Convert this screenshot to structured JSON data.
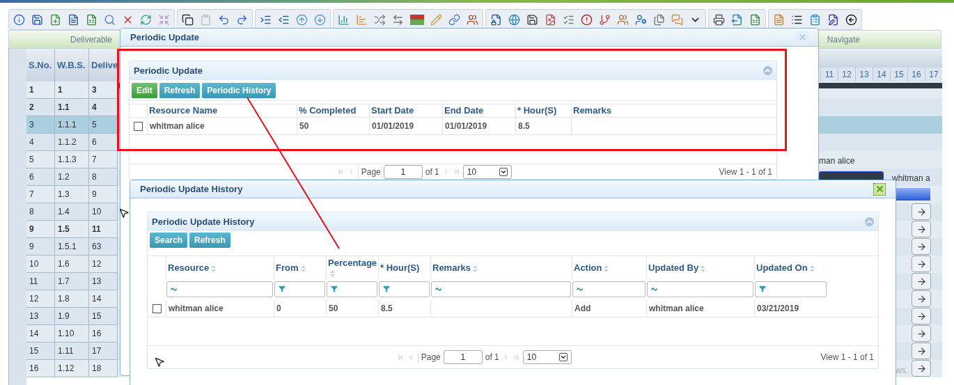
{
  "section_headers": [
    {
      "label": "Deliverable"
    },
    {
      "label": "Navigate"
    }
  ],
  "grid": {
    "columns": [
      "S.No.",
      "W.B.S.",
      "Delive"
    ],
    "rows": [
      {
        "s_no": "1",
        "wbs": "1",
        "deliverable": "3",
        "bold": true,
        "selected": false
      },
      {
        "s_no": "2",
        "wbs": "1.1",
        "deliverable": "4",
        "bold": true,
        "selected": false
      },
      {
        "s_no": "3",
        "wbs": "1.1.1",
        "deliverable": "5",
        "bold": false,
        "selected": true
      },
      {
        "s_no": "4",
        "wbs": "1.1.2",
        "deliverable": "6",
        "bold": false,
        "selected": false
      },
      {
        "s_no": "5",
        "wbs": "1.1.3",
        "deliverable": "7",
        "bold": false,
        "selected": false
      },
      {
        "s_no": "6",
        "wbs": "1.2",
        "deliverable": "8",
        "bold": false,
        "selected": false
      },
      {
        "s_no": "7",
        "wbs": "1.3",
        "deliverable": "9",
        "bold": false,
        "selected": false
      },
      {
        "s_no": "8",
        "wbs": "1.4",
        "deliverable": "10",
        "bold": false,
        "selected": false
      },
      {
        "s_no": "9",
        "wbs": "1.5",
        "deliverable": "11",
        "bold": true,
        "selected": false
      },
      {
        "s_no": "9",
        "wbs": "1.5.1",
        "deliverable": "63",
        "bold": false,
        "selected": false
      },
      {
        "s_no": "10",
        "wbs": "1.6",
        "deliverable": "12",
        "bold": false,
        "selected": false
      },
      {
        "s_no": "11",
        "wbs": "1.7",
        "deliverable": "13",
        "bold": false,
        "selected": false
      },
      {
        "s_no": "12",
        "wbs": "1.8",
        "deliverable": "14",
        "bold": false,
        "selected": false
      },
      {
        "s_no": "13",
        "wbs": "1.9",
        "deliverable": "15",
        "bold": false,
        "selected": false
      },
      {
        "s_no": "14",
        "wbs": "1.10",
        "deliverable": "16",
        "bold": false,
        "selected": false
      },
      {
        "s_no": "15",
        "wbs": "1.11",
        "deliverable": "17",
        "bold": false,
        "selected": false
      },
      {
        "s_no": "16",
        "wbs": "1.12",
        "deliverable": "18",
        "bold": false,
        "selected": false
      }
    ]
  },
  "gantt": {
    "days": [
      "11",
      "12",
      "13",
      "14",
      "15",
      "16",
      "17"
    ],
    "rows": [
      {
        "kind": "summary"
      },
      {
        "kind": "empty"
      },
      {
        "kind": "empty"
      },
      {
        "kind": "empty"
      },
      {
        "kind": "label",
        "text": "man alice"
      },
      {
        "kind": "bar",
        "text": "whitman a"
      },
      {
        "kind": "progress"
      },
      {
        "kind": "arrow"
      },
      {
        "kind": "arrow"
      },
      {
        "kind": "arrow"
      },
      {
        "kind": "arrow"
      },
      {
        "kind": "arrow"
      },
      {
        "kind": "arrow"
      },
      {
        "kind": "arrow"
      },
      {
        "kind": "arrow"
      },
      {
        "kind": "arrow"
      },
      {
        "kind": "arrow",
        "text": "ws."
      }
    ]
  },
  "update_dialog": {
    "title": "Periodic Update",
    "close_active": false,
    "panel": {
      "title": "Periodic Update",
      "buttons": [
        {
          "label": "Edit",
          "kind": "success"
        },
        {
          "label": "Refresh",
          "kind": "info"
        },
        {
          "label": "Periodic History",
          "kind": "info"
        }
      ],
      "columns": [
        "Resource Name",
        "% Completed",
        "Start Date",
        "End Date",
        "* Hour(S)",
        "Remarks"
      ],
      "rows": [
        {
          "checked": false,
          "cells": [
            "whitman alice",
            "50",
            "01/01/2019",
            "01/01/2019",
            "8.5",
            ""
          ]
        }
      ],
      "pager": {
        "page_label": "Page",
        "page": "1",
        "of": "of 1",
        "page_size": "10",
        "view": "View 1 - 1 of 1"
      }
    }
  },
  "history_dialog": {
    "title": "Periodic Update History",
    "close_active": true,
    "panel": {
      "title": "Periodic Update History",
      "buttons": [
        {
          "label": "Search",
          "kind": "info"
        },
        {
          "label": "Refresh",
          "kind": "info"
        }
      ],
      "columns": [
        {
          "label": "Resource",
          "sortable": true,
          "kind": "text"
        },
        {
          "label": "From",
          "sortable": true,
          "kind": "select"
        },
        {
          "label": "Percentage",
          "sortable": true,
          "kind": "select"
        },
        {
          "label": "* Hour(S)",
          "sortable": false,
          "kind": "select"
        },
        {
          "label": "Remarks",
          "sortable": true,
          "kind": "text"
        },
        {
          "label": "Action",
          "sortable": true,
          "kind": "text"
        },
        {
          "label": "Updated By",
          "sortable": true,
          "kind": "text"
        },
        {
          "label": "Updated On",
          "sortable": true,
          "kind": "select"
        }
      ],
      "rows": [
        {
          "checked": false,
          "cells": [
            "whitman alice",
            "0",
            "50",
            "8.5",
            "",
            "Add",
            "whitman alice",
            "03/21/2019"
          ]
        }
      ],
      "pager": {
        "page_label": "Page",
        "page": "1",
        "of": "of 1",
        "page_size": "10",
        "view": "View 1 - 1 of 1"
      }
    }
  }
}
